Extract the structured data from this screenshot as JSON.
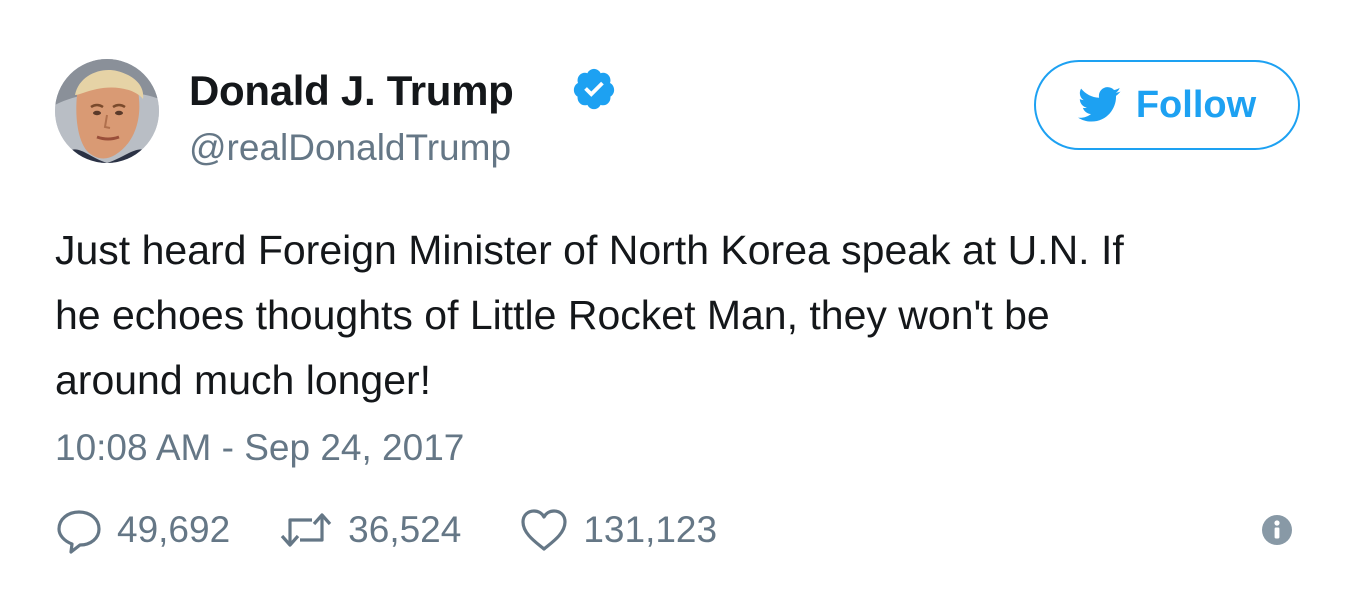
{
  "tweet": {
    "author": {
      "display_name": "Donald J. Trump",
      "handle": "@realDonaldTrump",
      "verified": true,
      "avatar_icon": "profile-photo-avatar"
    },
    "follow_button": {
      "label": "Follow",
      "icon": "twitter-bird-icon"
    },
    "text_lines": [
      "Just heard Foreign Minister of North Korea speak at U.N. If",
      "he echoes thoughts of Little Rocket Man, they won't be",
      "around much longer!"
    ],
    "timestamp": "10:08 AM - Sep 24, 2017",
    "stats": {
      "replies": "49,692",
      "retweets": "36,524",
      "likes": "131,123"
    },
    "icons": {
      "reply": "speech-bubble-icon",
      "retweet": "retweet-arrows-icon",
      "like": "heart-icon",
      "info": "info-icon",
      "verified": "verified-badge-icon"
    }
  },
  "colors": {
    "accent": "#1da1f2",
    "text_primary": "#14171a",
    "text_secondary": "#657786",
    "background": "#ffffff"
  }
}
